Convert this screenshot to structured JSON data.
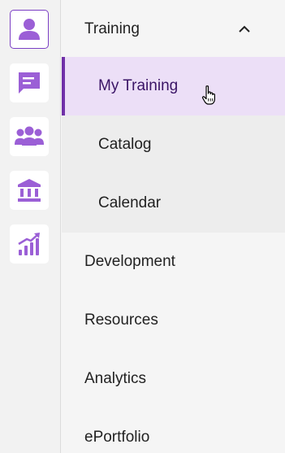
{
  "rail": {
    "items": [
      {
        "icon": "person-icon",
        "active": true
      },
      {
        "icon": "chat-icon",
        "active": false
      },
      {
        "icon": "group-icon",
        "active": false
      },
      {
        "icon": "institution-icon",
        "active": false
      },
      {
        "icon": "analytics-chart-icon",
        "active": false
      }
    ],
    "accent_color": "#7b3fc4",
    "icon_color": "#9b5fd6"
  },
  "menu": {
    "training": {
      "label": "Training",
      "expanded": true,
      "children": [
        {
          "label": "My Training",
          "selected": true
        },
        {
          "label": "Catalog",
          "selected": false
        },
        {
          "label": "Calendar",
          "selected": false
        }
      ]
    },
    "items": [
      {
        "label": "Development"
      },
      {
        "label": "Resources"
      },
      {
        "label": "Analytics"
      },
      {
        "label": "ePortfolio"
      }
    ],
    "selected_bg": "#ecdff7",
    "selected_border": "#7030a8"
  }
}
